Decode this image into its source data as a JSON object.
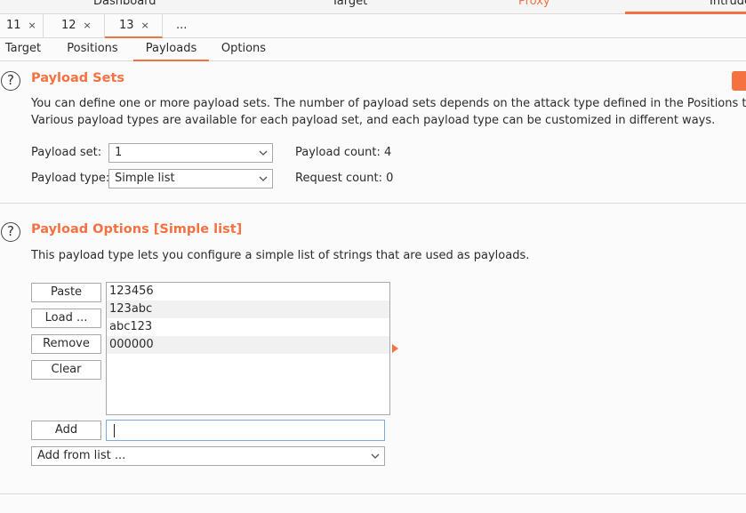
{
  "tool_tabs": [
    "Dashboard",
    "Target",
    "Proxy",
    "Intruder"
  ],
  "instance_tabs": [
    {
      "label": "11",
      "close": "×"
    },
    {
      "label": "12",
      "close": "×"
    },
    {
      "label": "13",
      "close": "×"
    },
    {
      "label": "..."
    }
  ],
  "sub_tabs": [
    "Target",
    "Positions",
    "Payloads",
    "Options"
  ],
  "help_icon_glyph": "?",
  "payload_sets": {
    "title": "Payload Sets",
    "desc1": "You can define one or more payload sets. The number of payload sets depends on the attack type defined in the Positions tab.",
    "desc2": "Various payload types are available for each payload set, and each payload type can be customized in different ways.",
    "set_label": "Payload set:",
    "set_value": "1",
    "type_label": "Payload type:",
    "type_value": "Simple list",
    "count_label": "Payload count: 4",
    "request_label": "Request count: 0"
  },
  "payload_options": {
    "title": "Payload Options [Simple list]",
    "desc": "This payload type lets you configure a simple list of strings that are used as payloads.",
    "buttons": {
      "paste": "Paste",
      "load": "Load ...",
      "remove": "Remove",
      "clear": "Clear",
      "add": "Add"
    },
    "items": [
      "123456",
      "123abc",
      "abc123",
      "000000"
    ],
    "add_value": "",
    "add_from_list": "Add from list ..."
  },
  "colors": {
    "accent": "#f47142"
  }
}
